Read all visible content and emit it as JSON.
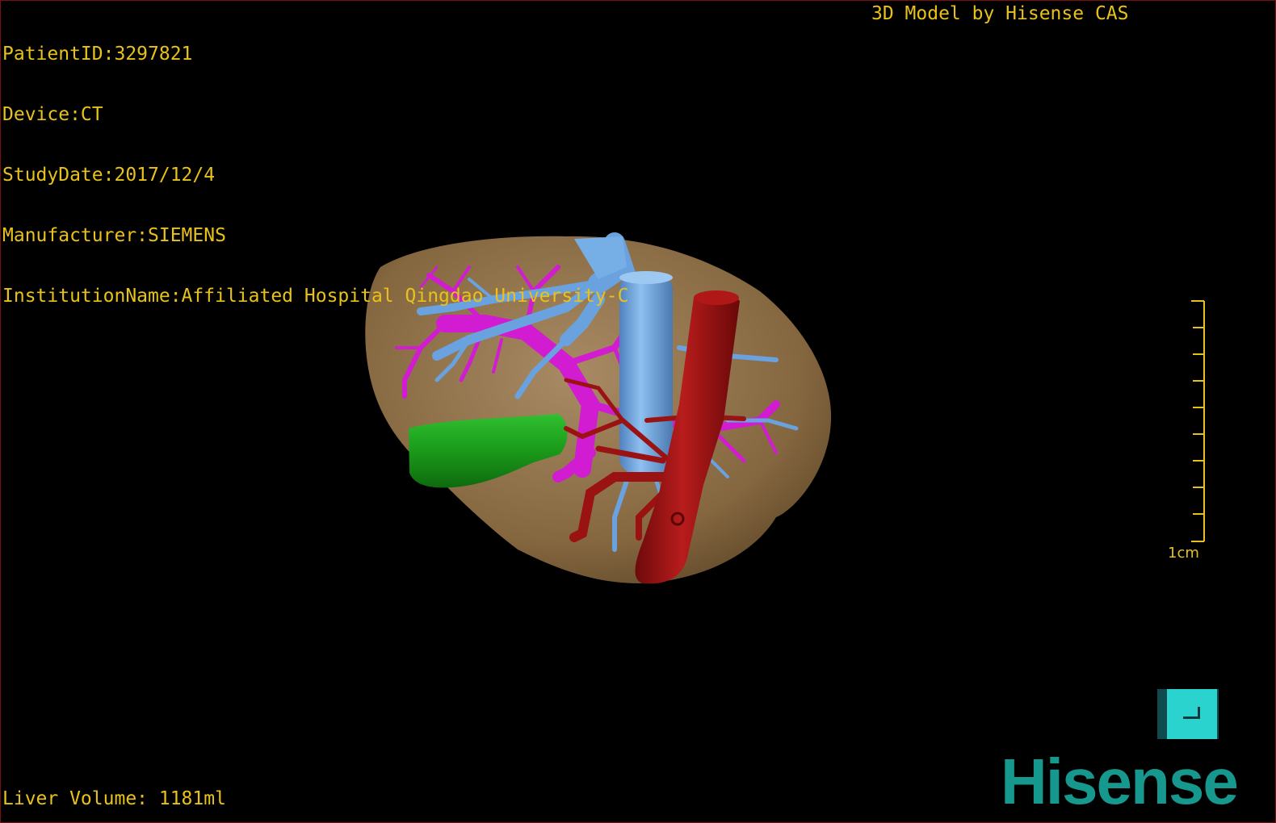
{
  "header": {
    "patient_id": "PatientID:3297821",
    "device": "Device:CT",
    "study_date": "StudyDate:2017/12/4",
    "manufacturer": "Manufacturer:SIEMENS",
    "institution": "InstitutionName:Affiliated Hospital Qingdao University-C",
    "credit": "3D Model by Hisense CAS"
  },
  "footer": {
    "liver_volume": "Liver Volume: 1181ml"
  },
  "scale_bar": {
    "label": "1cm"
  },
  "brand": {
    "logo_text": "Hisense"
  },
  "colors": {
    "overlay_text": "#e8c21a",
    "liver": "#8c6c48",
    "hepatic_vein": "#6aa2e0",
    "portal_vein": "#d21cd2",
    "artery": "#9a1212",
    "gallbladder": "#1c9a1c",
    "brand": "#17988e",
    "button": "#2bd3cf"
  }
}
